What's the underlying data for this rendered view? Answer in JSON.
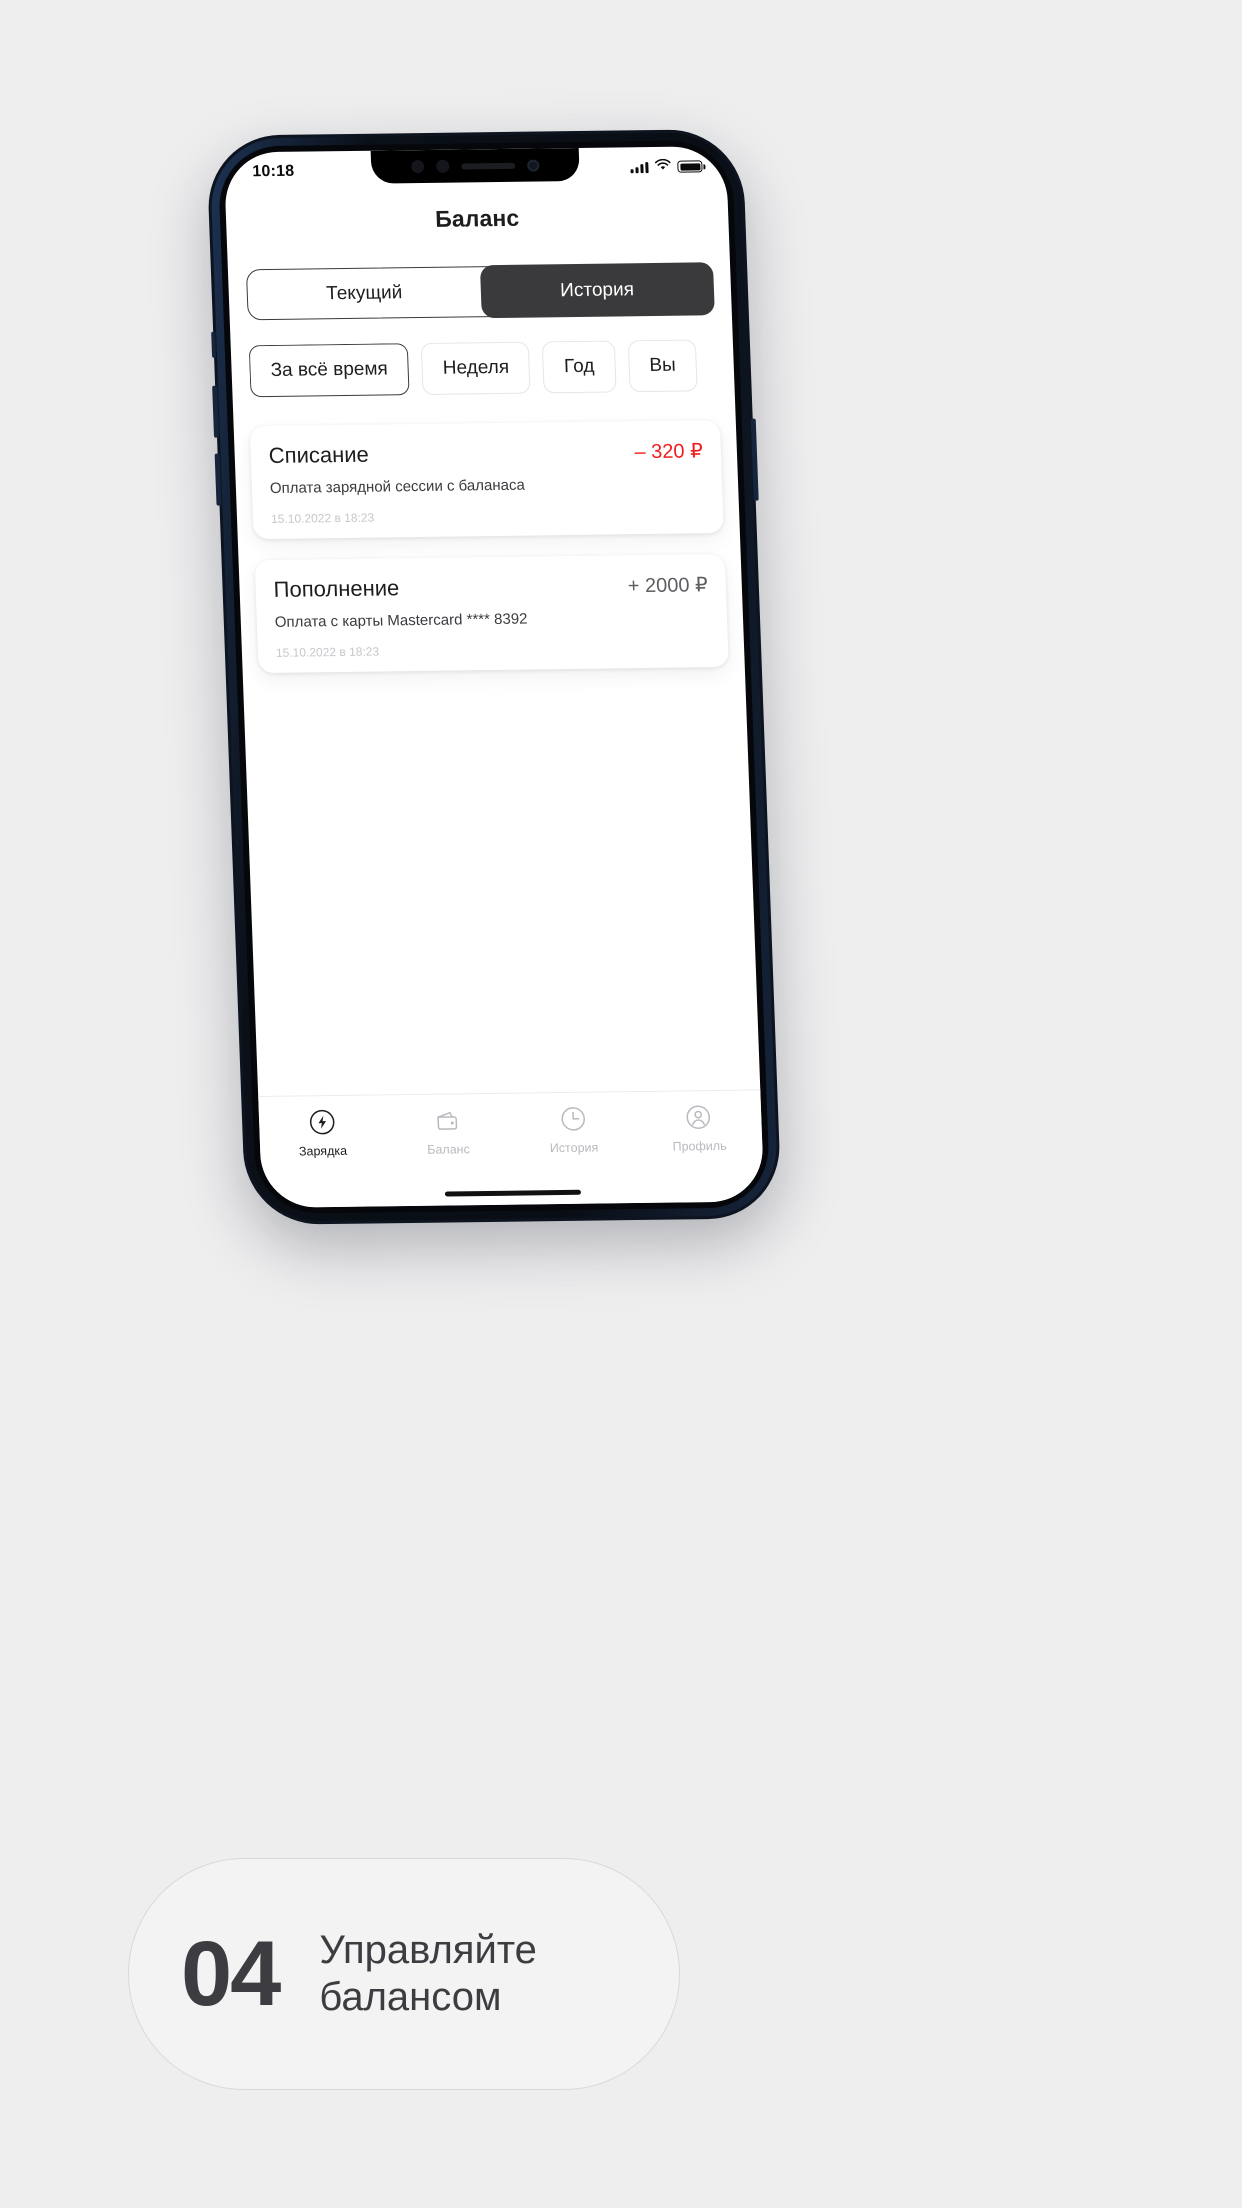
{
  "status_bar": {
    "time": "10:18",
    "signal_icon": "cellular-signal-icon",
    "wifi_icon": "wifi-icon",
    "battery_icon": "battery-icon"
  },
  "app": {
    "title": "Баланс"
  },
  "segmented": {
    "tabs": [
      {
        "label": "Текущий",
        "active": false
      },
      {
        "label": "История",
        "active": true
      }
    ]
  },
  "filters": {
    "chips": [
      {
        "label": "За всё время",
        "selected": true
      },
      {
        "label": "Неделя",
        "selected": false
      },
      {
        "label": "Год",
        "selected": false
      },
      {
        "label": "Вы",
        "selected": false
      }
    ]
  },
  "transactions": [
    {
      "title": "Списание",
      "amount": "– 320 ₽",
      "sign": "negative",
      "description": "Оплата зарядной сессии с баланаса",
      "date": "15.10.2022 в 18:23"
    },
    {
      "title": "Пополнение",
      "amount": "+ 2000 ₽",
      "sign": "positive",
      "description": "Оплата с карты Mastercard **** 8392",
      "date": "15.10.2022 в 18:23"
    }
  ],
  "tabbar": {
    "items": [
      {
        "label": "Зарядка",
        "icon": "charging-plug-icon",
        "active": true
      },
      {
        "label": "Баланс",
        "icon": "wallet-icon",
        "active": false
      },
      {
        "label": "История",
        "icon": "clock-history-icon",
        "active": false
      },
      {
        "label": "Профиль",
        "icon": "person-profile-icon",
        "active": false
      }
    ]
  },
  "caption": {
    "number": "04",
    "line1": "Управляйте",
    "line2": "балансом"
  },
  "colors": {
    "page_background": "#eeeeef",
    "accent_dark": "#3a3a3c",
    "negative": "#f21c1c",
    "muted": "#c7c7cc"
  }
}
